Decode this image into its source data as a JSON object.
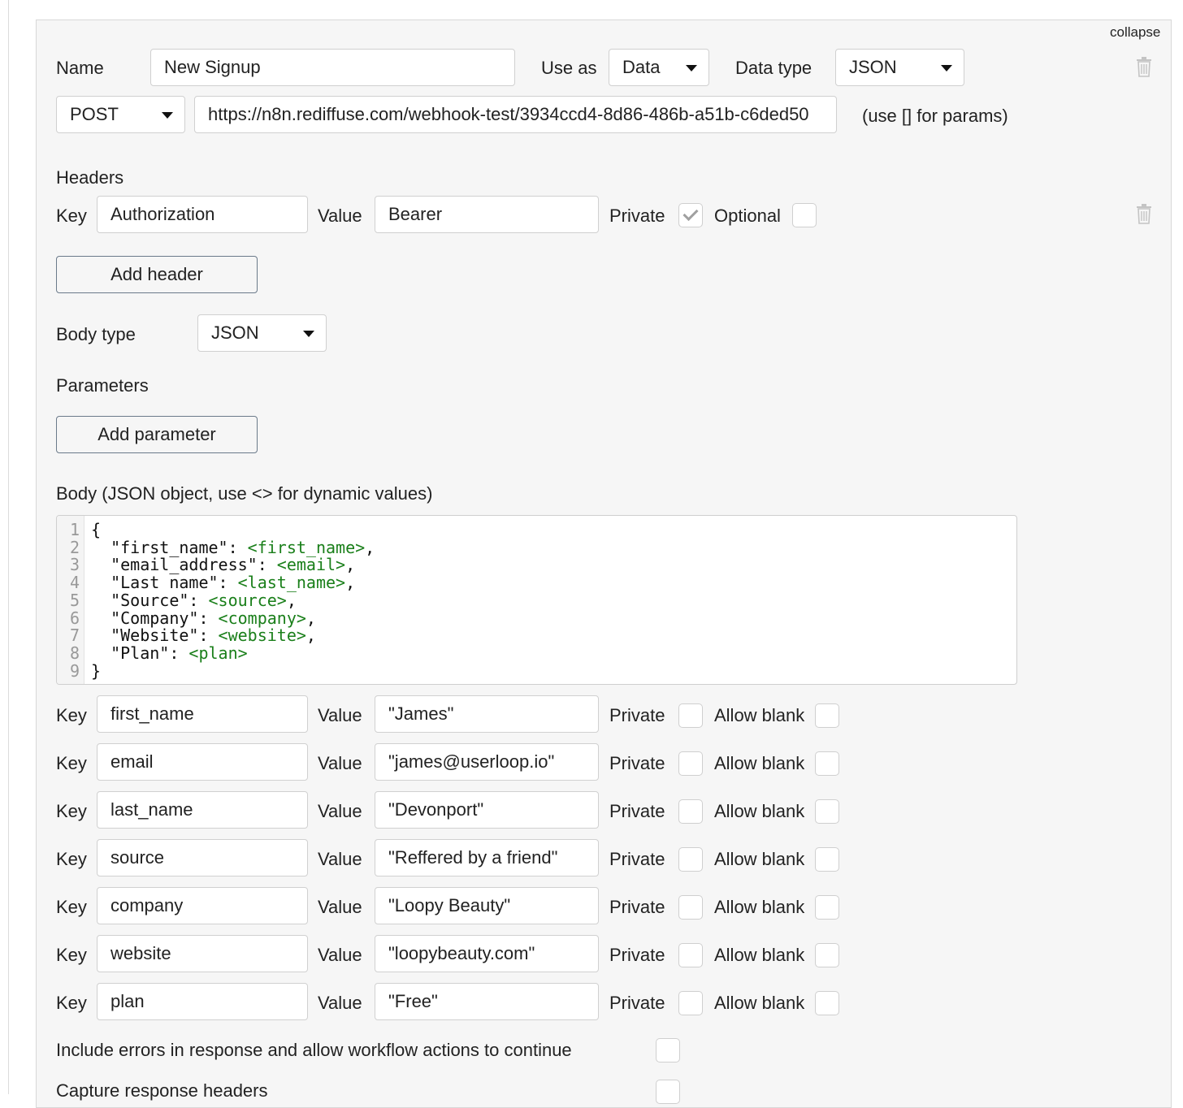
{
  "header": {
    "collapse_label": "collapse",
    "name_label": "Name",
    "name_value": "New Signup",
    "use_as_label": "Use as",
    "use_as_value": "Data",
    "data_type_label": "Data type",
    "data_type_value": "JSON"
  },
  "request": {
    "method": "POST",
    "url": "https://n8n.rediffuse.com/webhook-test/3934ccd4-8d86-486b-a51b-c6ded50",
    "url_hint": "(use [] for params)"
  },
  "headers_section": {
    "title": "Headers",
    "key_label": "Key",
    "value_label": "Value",
    "private_label": "Private",
    "optional_label": "Optional",
    "key_value": "Authorization",
    "value_value": "Bearer",
    "private_checked": true,
    "optional_checked": false,
    "add_header_label": "Add header"
  },
  "body_type": {
    "label": "Body type",
    "value": "JSON"
  },
  "parameters": {
    "title": "Parameters",
    "add_parameter_label": "Add parameter"
  },
  "body": {
    "label": "Body (JSON object, use <> for dynamic values)",
    "lines": [
      {
        "n": "1",
        "text": "{",
        "dyn": "",
        "tail": ""
      },
      {
        "n": "2",
        "text": "  \"first_name\": ",
        "dyn": "<first_name>",
        "tail": ","
      },
      {
        "n": "3",
        "text": "  \"email_address\": ",
        "dyn": "<email>",
        "tail": ","
      },
      {
        "n": "4",
        "text": "  \"Last name\": ",
        "dyn": "<last_name>",
        "tail": ","
      },
      {
        "n": "5",
        "text": "  \"Source\": ",
        "dyn": "<source>",
        "tail": ","
      },
      {
        "n": "6",
        "text": "  \"Company\": ",
        "dyn": "<company>",
        "tail": ","
      },
      {
        "n": "7",
        "text": "  \"Website\": ",
        "dyn": "<website>",
        "tail": ","
      },
      {
        "n": "8",
        "text": "  \"Plan\": ",
        "dyn": "<plan>",
        "tail": ""
      },
      {
        "n": "9",
        "text": "}",
        "dyn": "",
        "tail": ""
      }
    ]
  },
  "param_rows": {
    "key_label": "Key",
    "value_label": "Value",
    "private_label": "Private",
    "allow_blank_label": "Allow blank",
    "rows": [
      {
        "key": "first_name",
        "value": "\"James\""
      },
      {
        "key": "email",
        "value": "\"james@userloop.io\""
      },
      {
        "key": "last_name",
        "value": "\"Devonport\""
      },
      {
        "key": "source",
        "value": "\"Reffered by a friend\""
      },
      {
        "key": "company",
        "value": "\"Loopy Beauty\""
      },
      {
        "key": "website",
        "value": "\"loopybeauty.com\""
      },
      {
        "key": "plan",
        "value": "\"Free\""
      }
    ]
  },
  "options": {
    "include_errors_label": "Include errors in response and allow workflow actions to continue",
    "capture_headers_label": "Capture response headers"
  },
  "icons": {
    "trash": "trash-icon",
    "caret": "caret-down-icon",
    "check": "check-icon"
  }
}
